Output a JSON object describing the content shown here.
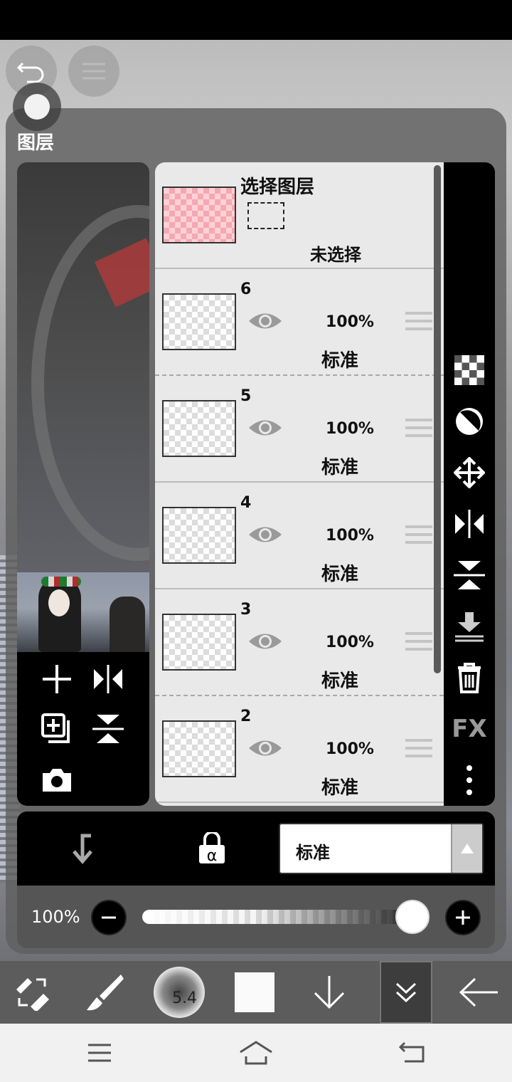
{
  "panel": {
    "title": "图层"
  },
  "selection_layer": {
    "title": "选择图层",
    "status": "未选择"
  },
  "layers": [
    {
      "number": "6",
      "opacity": "100%",
      "mode": "标准"
    },
    {
      "number": "5",
      "opacity": "100%",
      "mode": "标准"
    },
    {
      "number": "4",
      "opacity": "100%",
      "mode": "标准"
    },
    {
      "number": "3",
      "opacity": "100%",
      "mode": "标准"
    },
    {
      "number": "2",
      "opacity": "100%",
      "mode": "标准"
    }
  ],
  "right_tools": {
    "fx_label": "FX"
  },
  "blend_mode": {
    "value": "标准"
  },
  "opacity_control": {
    "label": "100%",
    "value_percent": 100
  },
  "toolbar": {
    "brush_size": "5.4"
  },
  "colors": {
    "accent_pink": "#f3a9b1",
    "panel_bg": "#5f5f5f",
    "toolbar_bg": "#5c5c5c"
  }
}
